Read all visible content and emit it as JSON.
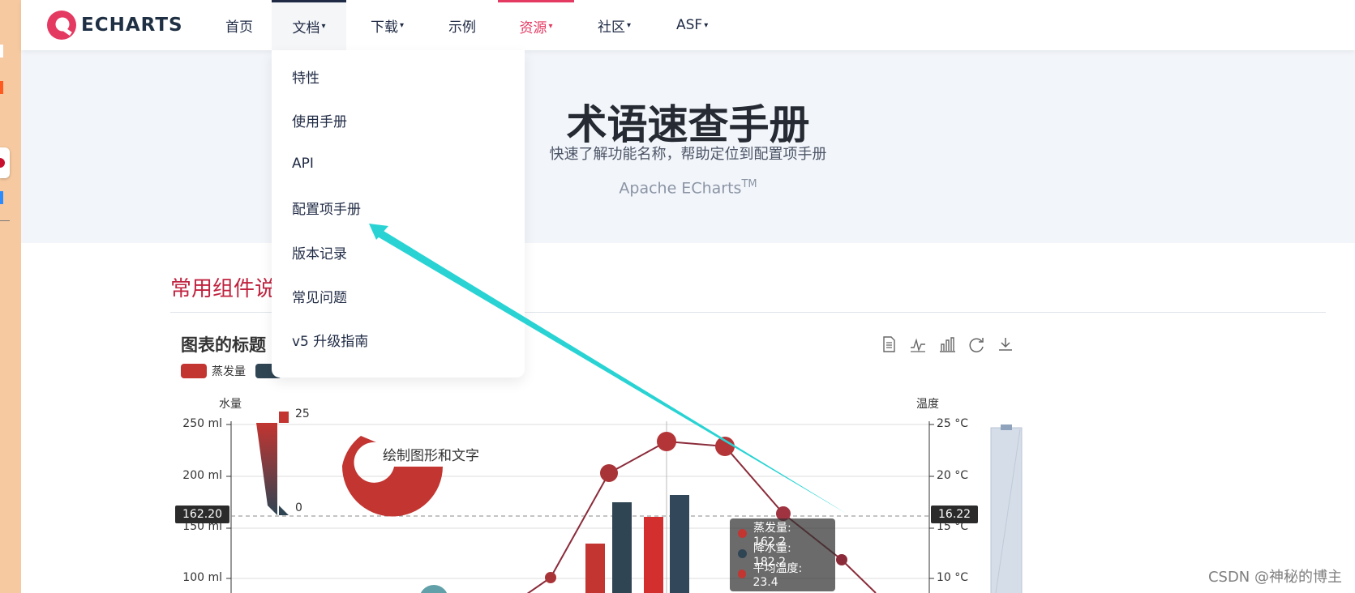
{
  "nav": {
    "logo_text": "ECHARTS",
    "items": [
      {
        "label": "首页",
        "caret": ""
      },
      {
        "label": "文档",
        "caret": "▾"
      },
      {
        "label": "下载",
        "caret": "▾"
      },
      {
        "label": "示例",
        "caret": ""
      },
      {
        "label": "资源",
        "caret": "▾"
      },
      {
        "label": "社区",
        "caret": "▾"
      },
      {
        "label": "ASF",
        "caret": "▾"
      }
    ]
  },
  "dropdown": {
    "items": [
      "特性",
      "使用手册",
      "API",
      "配置项手册",
      "版本记录",
      "常见问题",
      "v5 升级指南"
    ]
  },
  "hero": {
    "title": "术语速查手册",
    "subtitle": "快速了解功能名称，帮助定位到配置项手册",
    "brand": "Apache ECharts",
    "brand_sup": "TM"
  },
  "section": {
    "title": "常用组件说明"
  },
  "chart": {
    "title": "图表的标题",
    "legend": [
      {
        "name": "蒸发量",
        "color": "#c23531"
      },
      {
        "name": "",
        "color": "#2f4554"
      }
    ],
    "left_axis_name": "水量",
    "right_axis_name": "温度",
    "left_ticks": [
      "250 ml",
      "200 ml",
      "150 ml",
      "100 ml"
    ],
    "right_ticks": [
      "25 °C",
      "20 °C",
      "15 °C",
      "10 °C"
    ],
    "pointer_left": "162.20",
    "pointer_right": "16.22",
    "visualmap_top": "25",
    "visualmap_bottom": "0",
    "graphic_text": "绘制图形和文字",
    "tooltip": [
      {
        "label": "蒸发量: 162.2",
        "color": "#c23531"
      },
      {
        "label": "降水量: 182.2",
        "color": "#2f4554"
      },
      {
        "label": "平均温度: 23.4",
        "color": "#c23531"
      }
    ]
  },
  "watermark": "CSDN @神秘的博主",
  "colors": {
    "accent_red": "#e43961",
    "section_red": "#c0233f",
    "hero_bg": "#f2f5fa",
    "arrow": "#29d3d3"
  }
}
